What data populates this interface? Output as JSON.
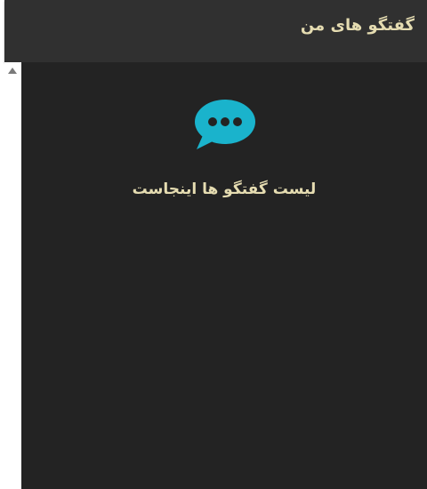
{
  "header": {
    "title": "گفتگو های من"
  },
  "conversations": {
    "empty_message": "لیست گفتگو ها اینجاست",
    "icon": "chat-bubble-icon"
  },
  "colors": {
    "background": "#232323",
    "header_background": "#303030",
    "text_accent": "#e5dcb1",
    "icon_accent": "#1ab3cc"
  }
}
